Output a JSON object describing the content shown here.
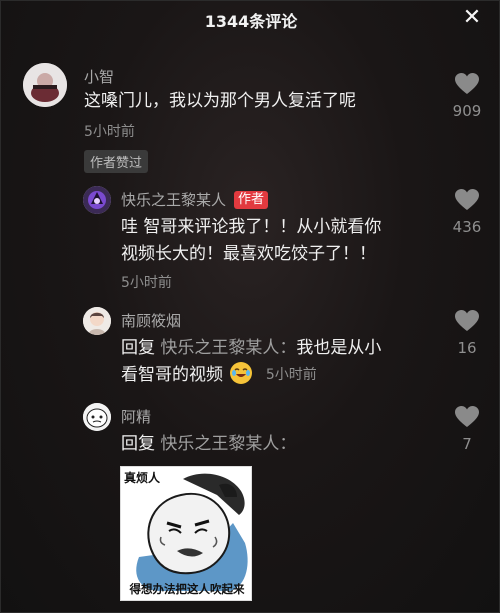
{
  "header": {
    "title": "1344条评论",
    "close_label": "✕"
  },
  "comments": [
    {
      "username": "小智",
      "text": "这嗓门儿，我以为那个男人复活了呢",
      "time": "5小时前",
      "badge": "作者赞过",
      "likes": "909"
    },
    {
      "username": "快乐之王黎某人",
      "author_tag": "作者",
      "text_line1": "哇 智哥来评论我了！！从小就看你",
      "text_line2": "视频长大的！最喜欢吃饺子了！！",
      "time": "5小时前",
      "likes": "436"
    },
    {
      "username": "南顾筱烟",
      "reply_prefix": "回复",
      "reply_target": "快乐之王黎某人：",
      "text_line1": "我也是从小",
      "text_line2": "看智哥的视频",
      "time": "5小时前",
      "likes": "16"
    },
    {
      "username": "阿精",
      "reply_prefix": "回复",
      "reply_target": "快乐之王黎某人：",
      "likes": "7",
      "sticker": {
        "top_text": "真烦人",
        "bottom_text": "得想办法把这人吹起来"
      }
    }
  ],
  "colors": {
    "background": "#141414",
    "author_badge": "#e23a3f",
    "text": "#f0f0f0",
    "muted": "#8d8d8d"
  },
  "icons": {
    "like": "heart-icon",
    "close": "close-icon",
    "emoji": "crying-laughing-emoji-icon"
  }
}
